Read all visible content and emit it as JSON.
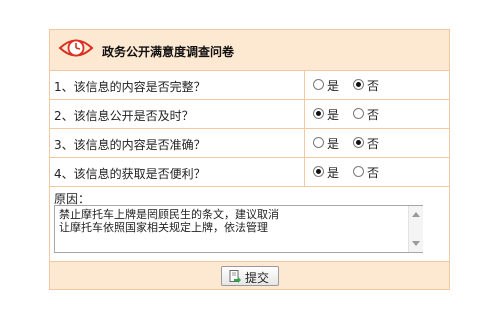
{
  "survey": {
    "title": "政务公开满意度调查问卷",
    "questions": [
      {
        "text": "1、该信息的内容是否完整？",
        "yes_label": "是",
        "no_label": "否",
        "selected": "no"
      },
      {
        "text": "2、该信息公开是否及时？",
        "yes_label": "是",
        "no_label": "否",
        "selected": "yes"
      },
      {
        "text": "3、该信息的内容是否准确？",
        "yes_label": "是",
        "no_label": "否",
        "selected": "no"
      },
      {
        "text": "4、该信息的获取是否便利？",
        "yes_label": "是",
        "no_label": "否",
        "selected": "yes"
      }
    ],
    "reason_label": "原因：",
    "reason_text": "禁止摩托车上牌是罔顾民生的条文，建议取消\n让摩托车依照国家相关规定上牌，依法管理",
    "submit_label": "提交"
  },
  "colors": {
    "header_bg": "#fde8d2",
    "border": "#f2c8a3",
    "logo": "#d9301f"
  },
  "icons": {
    "logo": "clock-eye-icon",
    "submit": "document-arrow-icon"
  }
}
